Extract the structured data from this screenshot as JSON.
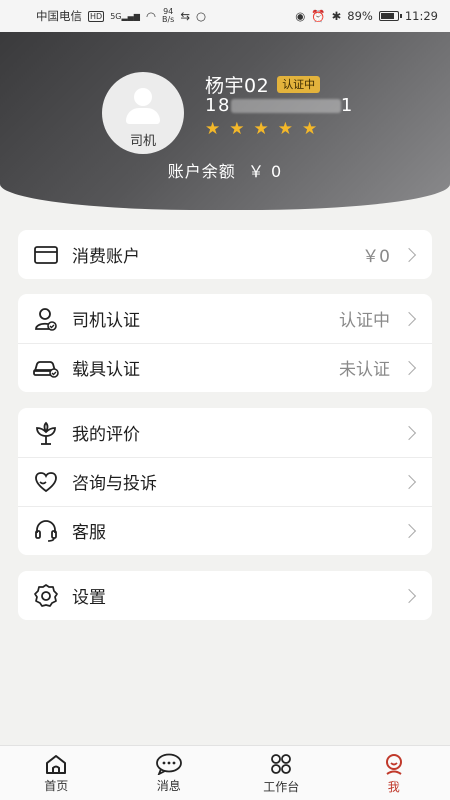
{
  "status_bar": {
    "carrier": "中国电信",
    "hd": "HD",
    "signal": "5G",
    "speed_value": "94",
    "speed_unit": "B/s",
    "battery": "89%",
    "time": "11:29"
  },
  "profile": {
    "avatar_role": "司机",
    "name": "杨宇02",
    "badge": "认证中",
    "phone_prefix": "18",
    "phone_suffix": "1",
    "rating_stars": 5,
    "balance_label": "账户余额",
    "balance_value": "￥ 0"
  },
  "cards": {
    "account": {
      "label": "消费账户",
      "value": "￥0",
      "icon": "wallet-icon"
    },
    "driver_cert": {
      "label": "司机认证",
      "value": "认证中",
      "icon": "driver-icon"
    },
    "vehicle_cert": {
      "label": "载具认证",
      "value": "未认证",
      "icon": "car-icon"
    },
    "my_reviews": {
      "label": "我的评价",
      "icon": "flower-icon"
    },
    "complaints": {
      "label": "咨询与投诉",
      "icon": "heart-chat-icon"
    },
    "service": {
      "label": "客服",
      "icon": "headset-icon"
    },
    "settings": {
      "label": "设置",
      "icon": "gear-icon"
    }
  },
  "tabbar": {
    "home": "首页",
    "messages": "消息",
    "workbench": "工作台",
    "me": "我"
  },
  "colors": {
    "accent_gold": "#e3b33c",
    "star": "#f4b829",
    "active_tab": "#c0392b"
  }
}
